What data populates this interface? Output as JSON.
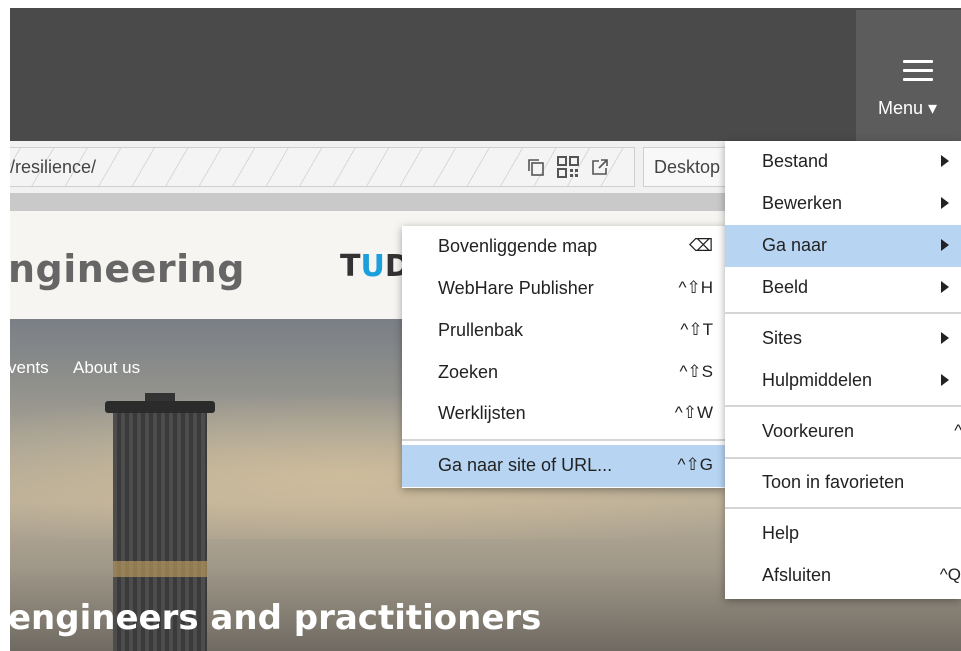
{
  "topbar": {
    "menu_label": "Menu ▾"
  },
  "urlbar": {
    "url": "/resilience/",
    "device": "Desktop"
  },
  "site": {
    "title": "ngineering",
    "logo_t": "T",
    "logo_u": "U",
    "logo_d": "D",
    "nav": [
      "vents",
      "About us"
    ],
    "headline": "engineers and practitioners"
  },
  "submenu": {
    "items": [
      {
        "label": "Bovenliggende map",
        "shortcut": "⌫"
      },
      {
        "label": "WebHare Publisher",
        "shortcut": "^⇧H"
      },
      {
        "label": "Prullenbak",
        "shortcut": "^⇧T"
      },
      {
        "label": "Zoeken",
        "shortcut": "^⇧S"
      },
      {
        "label": "Werklijsten",
        "shortcut": "^⇧W"
      },
      {
        "label": "Ga naar site of URL...",
        "shortcut": "^⇧G"
      }
    ]
  },
  "mainmenu": {
    "items": [
      {
        "label": "Bestand"
      },
      {
        "label": "Bewerken"
      },
      {
        "label": "Ga naar"
      },
      {
        "label": "Beeld"
      },
      {
        "label": "Sites"
      },
      {
        "label": "Hulpmiddelen"
      },
      {
        "label": "Voorkeuren",
        "shortcut": "^,"
      },
      {
        "label": "Toon in favorieten"
      },
      {
        "label": "Help"
      },
      {
        "label": "Afsluiten",
        "shortcut": "^Q"
      }
    ]
  }
}
